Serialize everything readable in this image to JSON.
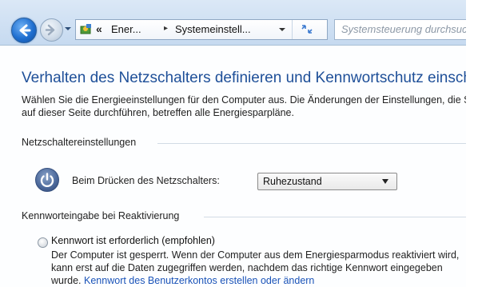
{
  "address_bar": {
    "chevron": "«",
    "crumb1": "Ener...",
    "crumb_separator": "▸",
    "crumb2": "Systemeinstell..."
  },
  "search": {
    "placeholder": "Systemsteuerung durchsuchen"
  },
  "page": {
    "title": "Verhalten des Netzschalters definieren und Kennwortschutz einschalten",
    "description_line1": "Wählen Sie die Energieeinstellungen für den Computer aus. Die Änderungen der Einstellungen, die Sie",
    "description_line2": "auf dieser Seite durchführen, betreffen alle Energiesparpläne."
  },
  "power_settings": {
    "section_label": "Netzschaltereinstellungen",
    "button_label": "Beim Drücken des Netzschalters:",
    "selected_option": "Ruhezustand"
  },
  "password_settings": {
    "section_label": "Kennworteingabe bei Reaktivierung",
    "option1_label": "Kennwort ist erforderlich (empfohlen)",
    "option1_desc_line1": "Der Computer ist gesperrt. Wenn der Computer aus dem Energiesparmodus reaktiviert wird,",
    "option1_desc_line2": "kann erst auf die Daten zugegriffen werden, nachdem das richtige Kennwort eingegeben",
    "option1_desc_line3_prefix": "wurde.",
    "option1_link": "Kennwort des Benutzerkontos erstellen oder ändern"
  },
  "icons": {
    "back": "arrow-left-icon",
    "forward": "arrow-right-icon",
    "recent": "chevron-down-icon",
    "location": "control-panel-icon",
    "refresh": "refresh-icon",
    "power": "power-icon"
  },
  "colors": {
    "title": "#1e4f98",
    "link": "#1a53b8",
    "toolbar": "#cfe0f3"
  }
}
